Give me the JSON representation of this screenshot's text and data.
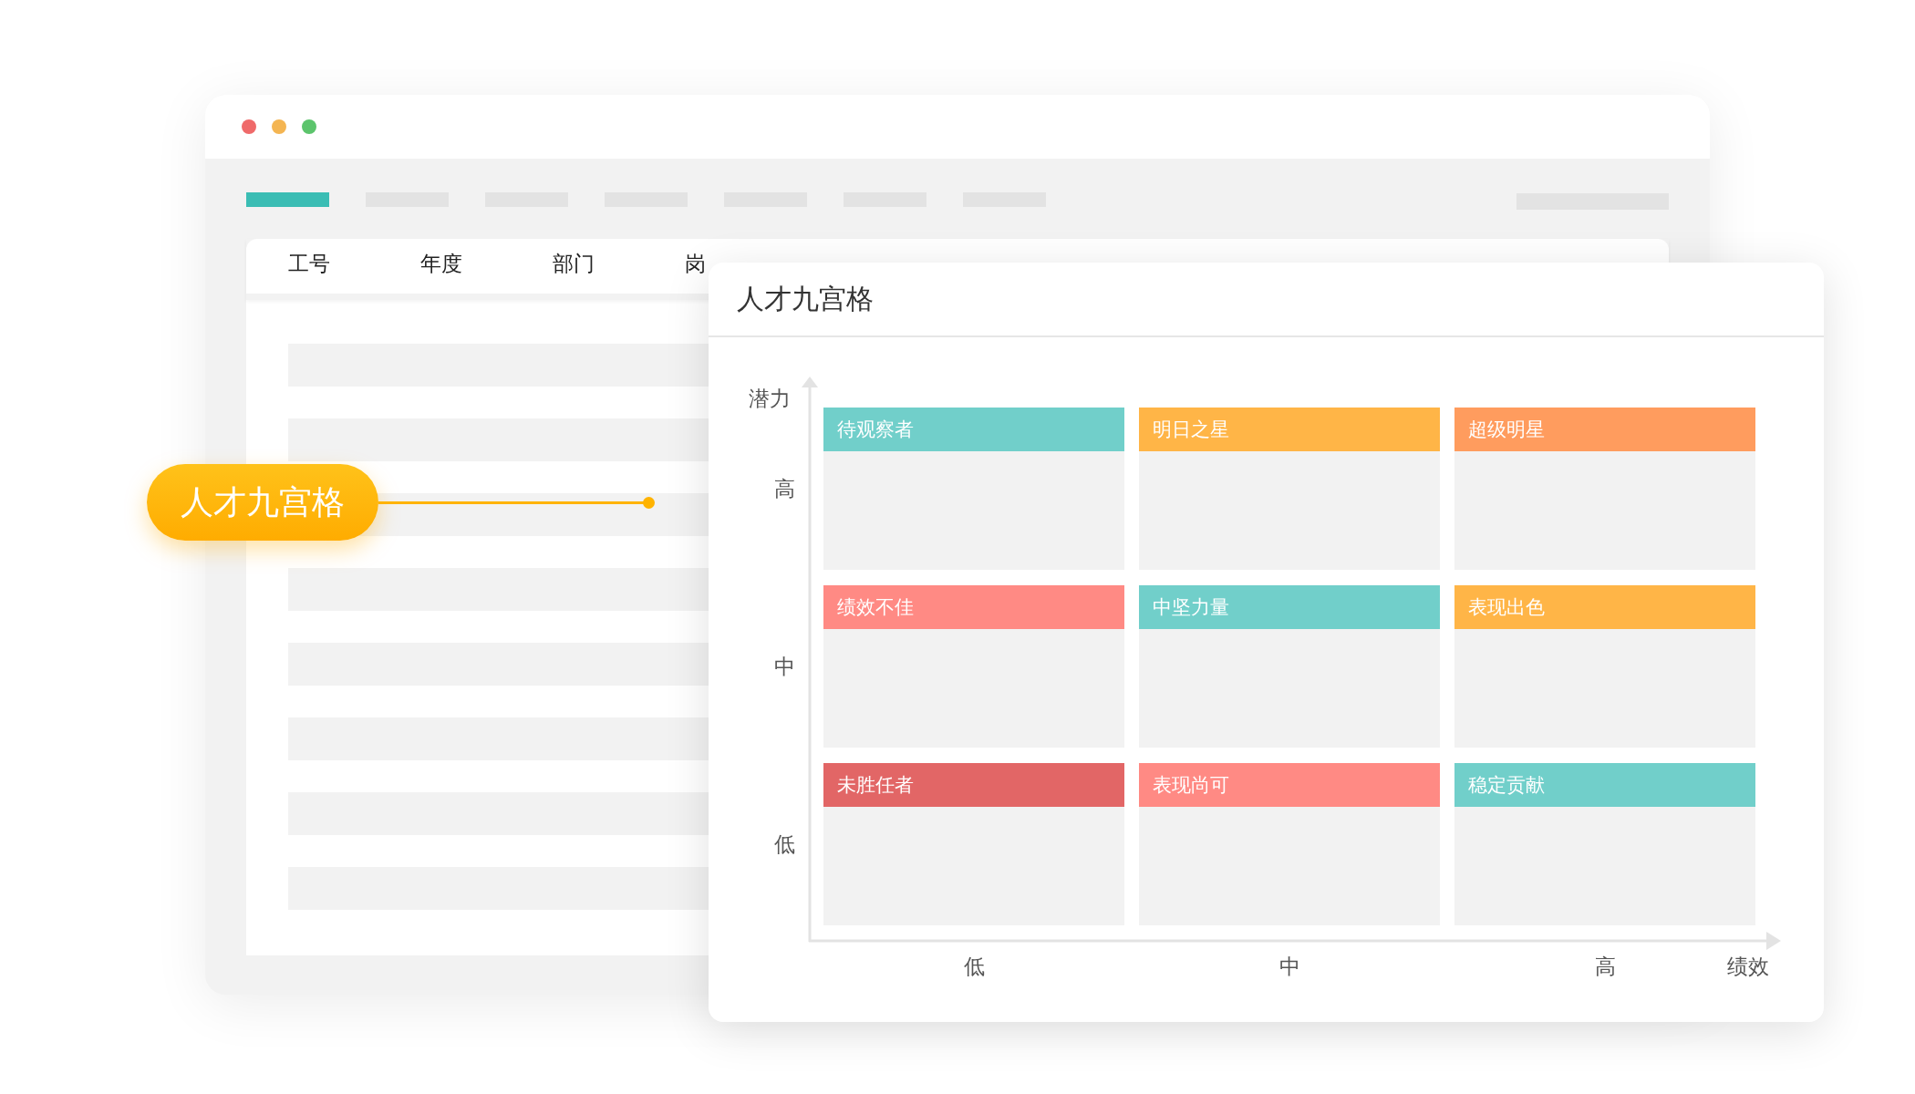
{
  "window": {
    "tabs": [
      {
        "selected": true
      },
      {
        "selected": false
      },
      {
        "selected": false
      },
      {
        "selected": false
      },
      {
        "selected": false
      },
      {
        "selected": false
      },
      {
        "selected": false
      }
    ]
  },
  "table": {
    "columns": [
      "工号",
      "年度",
      "部门",
      "岗"
    ],
    "rows": [
      {
        "kind": "placeholder"
      },
      {
        "kind": "placeholder"
      },
      {
        "kind": "placeholder"
      },
      {
        "kind": "placeholder"
      },
      {
        "kind": "placeholder"
      },
      {
        "kind": "placeholder"
      },
      {
        "kind": "placeholder"
      },
      {
        "kind": "placeholder"
      }
    ]
  },
  "callout": {
    "label": "人才九宫格"
  },
  "panel": {
    "title": "人才九宫格",
    "y_axis": {
      "title": "潜力",
      "levels": [
        "高",
        "中",
        "低"
      ]
    },
    "x_axis": {
      "title": "绩效",
      "levels": [
        "低",
        "中",
        "高"
      ]
    },
    "cells": [
      {
        "label": "待观察者",
        "color": "#71cfca"
      },
      {
        "label": "明日之星",
        "color": "#ffb547"
      },
      {
        "label": "超级明星",
        "color": "#ff9c5e"
      },
      {
        "label": "绩效不佳",
        "color": "#ff8a84"
      },
      {
        "label": "中坚力量",
        "color": "#71cfca"
      },
      {
        "label": "表现出色",
        "color": "#ffb547"
      },
      {
        "label": "未胜任者",
        "color": "#e26666"
      },
      {
        "label": "表现尚可",
        "color": "#ff8a84"
      },
      {
        "label": "稳定贡献",
        "color": "#71cfca"
      }
    ]
  }
}
